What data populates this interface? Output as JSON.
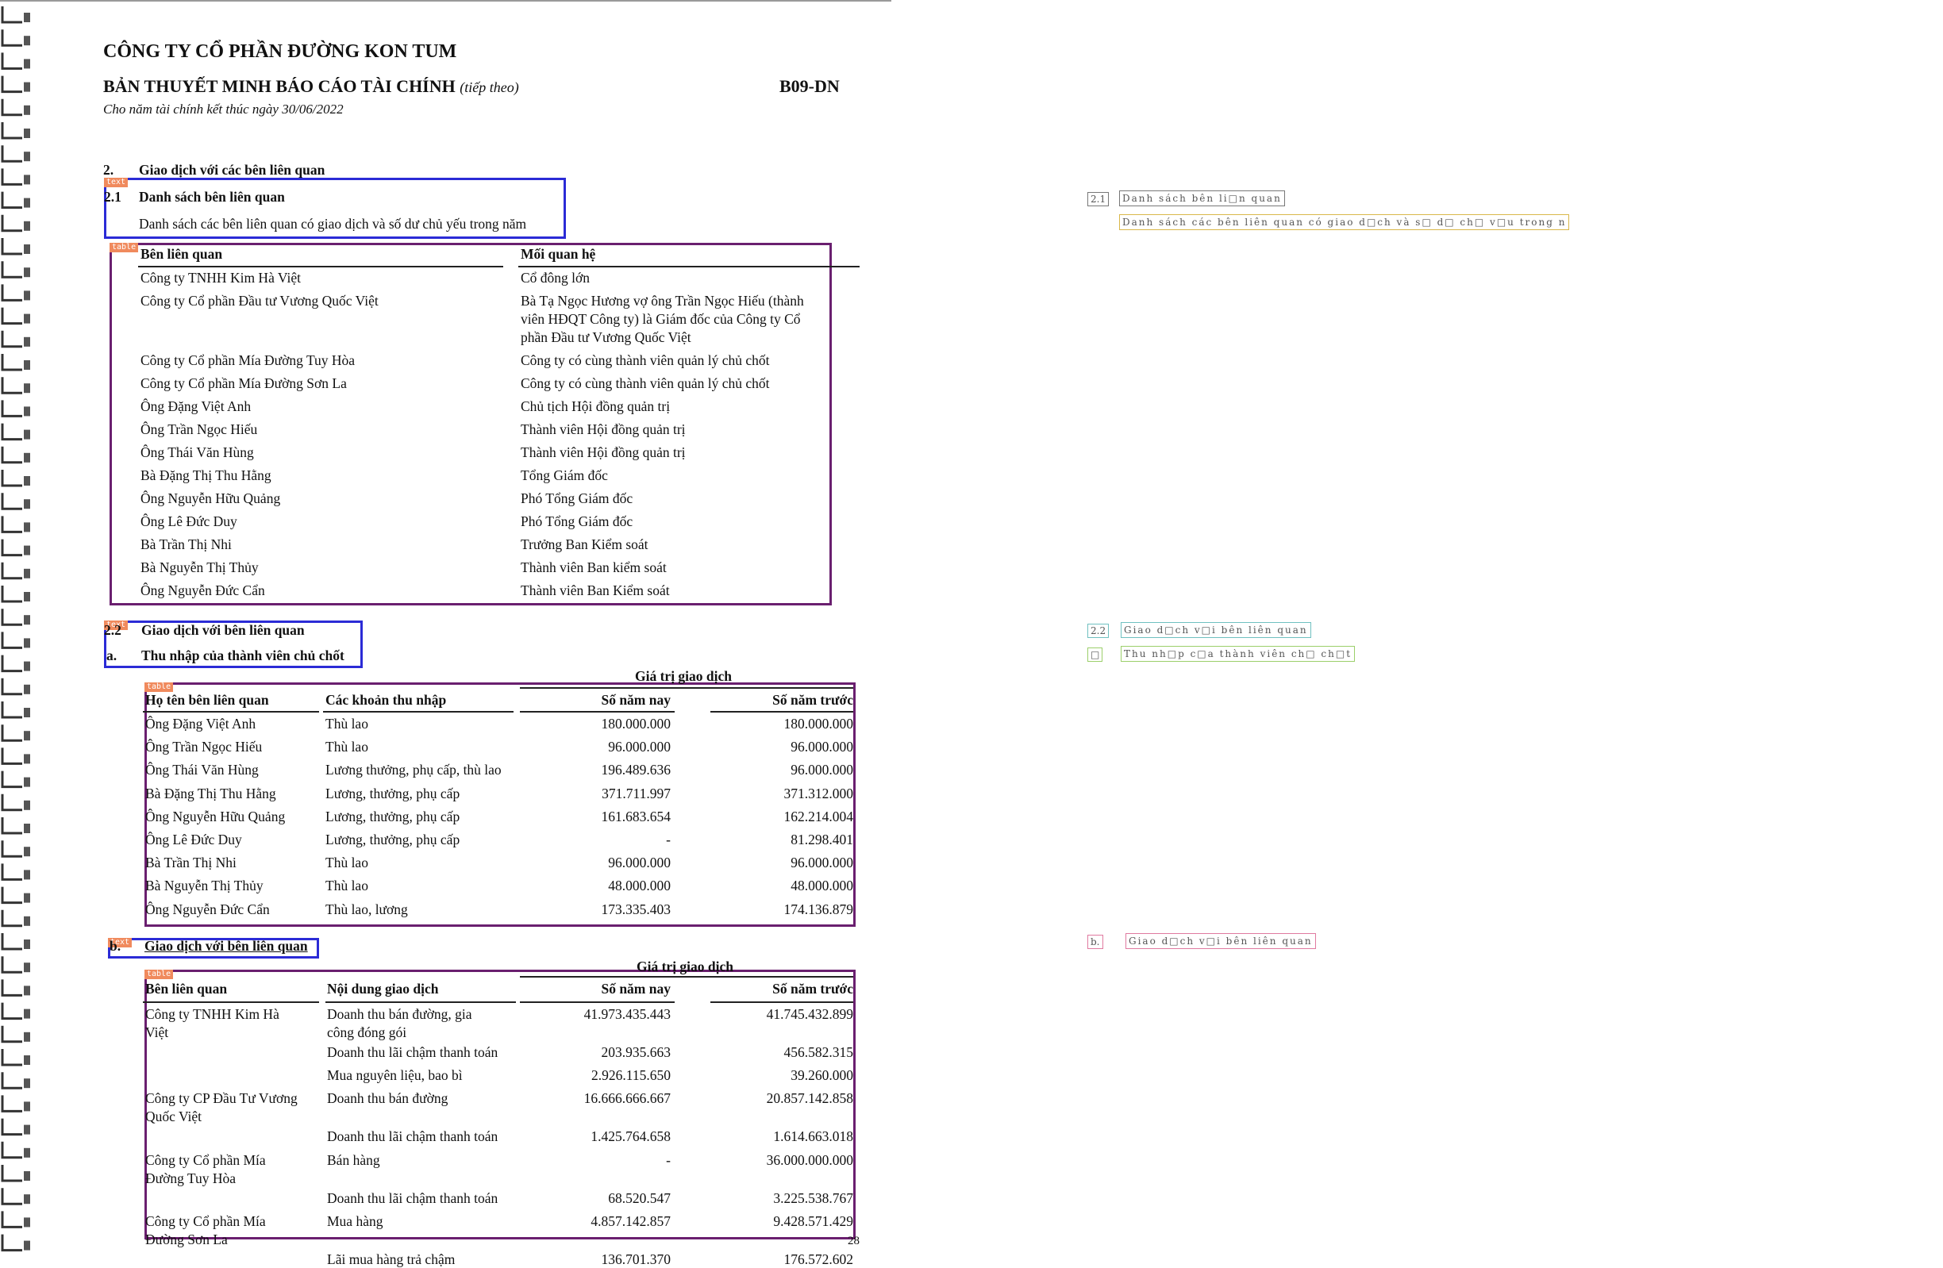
{
  "header": {
    "company": "CÔNG TY CỔ PHẦN ĐƯỜNG KON TUM",
    "report_title": "BẢN THUYẾT MINH BÁO CÁO TÀI CHÍNH",
    "report_title_suffix": "(tiếp theo)",
    "form_code": "B09-DN",
    "period": "Cho năm tài chính kết thúc ngày 30/06/2022"
  },
  "section2": {
    "num": "2.",
    "title": "Giao dịch với các bên liên quan"
  },
  "section21": {
    "num": "2.1",
    "title": "Danh sách bên liên quan",
    "desc": "Danh sách các bên liên quan có giao dịch và số dư chủ yếu trong năm"
  },
  "tags": {
    "text": "text",
    "table": "table"
  },
  "table1": {
    "headers": [
      "Bên liên quan",
      "Mối quan hệ"
    ],
    "rows": [
      {
        "party": "Công ty TNHH Kim Hà Việt",
        "rel": [
          "Cổ đông lớn"
        ]
      },
      {
        "party": "Công ty Cổ phần Đầu tư Vương Quốc Việt",
        "rel": [
          "Bà Tạ Ngọc Hương vợ ông Trần Ngọc Hiếu (thành",
          "viên HĐQT Công ty) là Giám đốc của Công ty Cổ",
          "phần Đầu tư Vương Quốc Việt"
        ]
      },
      {
        "party": "Công ty Cổ phần Mía Đường Tuy Hòa",
        "rel": [
          "Công ty có cùng thành viên quản lý chủ chốt"
        ]
      },
      {
        "party": "Công ty Cổ phần Mía Đường Sơn La",
        "rel": [
          "Công ty có cùng thành viên quản lý chủ chốt"
        ]
      },
      {
        "party": "Ông Đặng Việt Anh",
        "rel": [
          "Chủ tịch Hội đồng quản trị"
        ]
      },
      {
        "party": "Ông Trần Ngọc Hiếu",
        "rel": [
          "Thành viên Hội đồng quản trị"
        ]
      },
      {
        "party": "Ông Thái Văn Hùng",
        "rel": [
          "Thành viên Hội đồng quản trị"
        ]
      },
      {
        "party": "Bà Đặng Thị Thu Hằng",
        "rel": [
          "Tổng Giám đốc"
        ]
      },
      {
        "party": "Ông Nguyễn Hữu Quảng",
        "rel": [
          "Phó Tổng Giám đốc"
        ]
      },
      {
        "party": "Ông Lê Đức Duy",
        "rel": [
          "Phó Tổng Giám đốc"
        ]
      },
      {
        "party": "Bà Trần Thị Nhi",
        "rel": [
          "Trưởng Ban Kiểm soát"
        ]
      },
      {
        "party": "Bà Nguyễn Thị Thủy",
        "rel": [
          "Thành viên Ban kiểm soát"
        ]
      },
      {
        "party": "Ông Nguyễn Đức Cẩn",
        "rel": [
          "Thành viên Ban Kiểm soát"
        ]
      }
    ]
  },
  "section22": {
    "num": "2.2",
    "title": "Giao dịch với bên liên quan",
    "sub_num": "a.",
    "sub_title": "Thu nhập của thành viên chủ chốt"
  },
  "table2": {
    "group_header": "Giá trị giao dịch",
    "headers": [
      "Họ tên bên liên quan",
      "Các khoản thu nhập",
      "Số năm nay",
      "Số năm trước"
    ],
    "rows": [
      [
        "Ông Đặng Việt Anh",
        "Thù lao",
        "180.000.000",
        "180.000.000"
      ],
      [
        "Ông Trần Ngọc Hiếu",
        "Thù lao",
        "96.000.000",
        "96.000.000"
      ],
      [
        "Ông Thái Văn Hùng",
        "Lương thưởng, phụ cấp, thù lao",
        "196.489.636",
        "96.000.000"
      ],
      [
        "Bà Đặng Thị Thu Hằng",
        "Lương, thưởng, phụ cấp",
        "371.711.997",
        "371.312.000"
      ],
      [
        "Ông Nguyễn Hữu Quảng",
        "Lương, thưởng, phụ cấp",
        "161.683.654",
        "162.214.004"
      ],
      [
        "Ông Lê Đức Duy",
        "Lương, thưởng, phụ cấp",
        "-",
        "81.298.401"
      ],
      [
        "Bà Trần Thị Nhi",
        "Thù lao",
        "96.000.000",
        "96.000.000"
      ],
      [
        "Bà Nguyễn Thị Thủy",
        "Thù lao",
        "48.000.000",
        "48.000.000"
      ],
      [
        "Ông Nguyễn Đức Cẩn",
        "Thù lao, lương",
        "173.335.403",
        "174.136.879"
      ]
    ]
  },
  "section_b": {
    "num": "b.",
    "title": "Giao dịch với bên liên quan"
  },
  "table3": {
    "group_header": "Giá trị giao dịch",
    "headers": [
      "Bên liên quan",
      "Nội dung giao dịch",
      "Số năm nay",
      "Số năm trước"
    ],
    "rows": [
      {
        "party": [
          "Công ty TNHH Kim Hà",
          "Việt"
        ],
        "content": [
          "Doanh thu bán đường, gia",
          "công đóng gói"
        ],
        "cur": "41.973.435.443",
        "prev": "41.745.432.899"
      },
      {
        "party": [],
        "content": [
          "Doanh thu lãi chậm thanh toán"
        ],
        "cur": "203.935.663",
        "prev": "456.582.315"
      },
      {
        "party": [],
        "content": [
          "Mua nguyên liệu, bao bì"
        ],
        "cur": "2.926.115.650",
        "prev": "39.260.000"
      },
      {
        "party": [
          "Công ty CP Đầu Tư Vương",
          "Quốc Việt"
        ],
        "content": [
          "Doanh thu bán đường"
        ],
        "cur": "16.666.666.667",
        "prev": "20.857.142.858"
      },
      {
        "party": [],
        "content": [
          "Doanh thu lãi chậm thanh toán"
        ],
        "cur": "1.425.764.658",
        "prev": "1.614.663.018"
      },
      {
        "party": [
          "Công ty Cổ phần Mía",
          "Đường Tuy Hòa"
        ],
        "content": [
          "Bán hàng"
        ],
        "cur": "-",
        "prev": "36.000.000.000"
      },
      {
        "party": [],
        "content": [
          "Doanh thu lãi chậm thanh toán"
        ],
        "cur": "68.520.547",
        "prev": "3.225.538.767"
      },
      {
        "party": [
          "Công ty Cổ phần Mía",
          "Đường Sơn La"
        ],
        "content": [
          "Mua hàng"
        ],
        "cur": "4.857.142.857",
        "prev": "9.428.571.429"
      },
      {
        "party": [],
        "content": [
          "Lãi mua hàng trả chậm"
        ],
        "cur": "136.701.370",
        "prev": "176.572.602"
      }
    ]
  },
  "page_number": "28",
  "ocr_panel": {
    "items": [
      {
        "num": "2.1",
        "text": "Danh sách bên li□n quan",
        "color": "#777777"
      },
      {
        "num": "",
        "text": "Danh sách các bên liên quan có giao d□ch và s□ d□ ch□ v□u trong n",
        "color": "#d9b84a"
      },
      {
        "num": "2.2",
        "text": "Giao d□ch v□i bên liên quan",
        "color": "#6fc0c0"
      },
      {
        "num": "□",
        "text": "Thu nh□p c□a thành viên ch□ ch□t",
        "color": "#9bcf6a"
      },
      {
        "num": "b.",
        "text": "Giao d□ch v□i bên liên quan",
        "color": "#e07aa0"
      }
    ]
  },
  "colors": {
    "text_box": "#2b2bd6",
    "table_box": "#6a1f6f",
    "tag": "#f08a5d"
  }
}
